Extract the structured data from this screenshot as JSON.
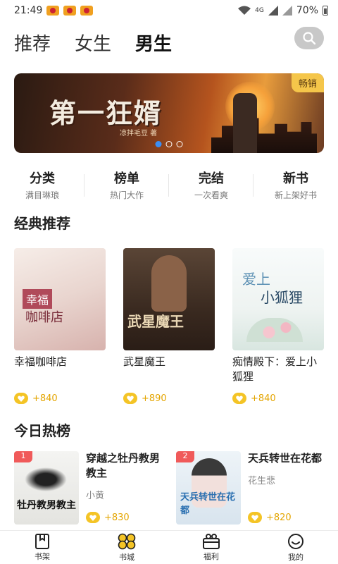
{
  "status_bar": {
    "time": "21:49",
    "network": "4G",
    "battery": "70%"
  },
  "top_tabs": [
    {
      "label": "推荐",
      "active": false
    },
    {
      "label": "女生",
      "active": false
    },
    {
      "label": "男生",
      "active": true
    }
  ],
  "banner": {
    "title": "第一狂婿",
    "author": "凉拌毛豆 著",
    "badge": "畅销",
    "dots": 3,
    "active_dot": 0
  },
  "categories": [
    {
      "title": "分类",
      "subtitle": "满目琳琅"
    },
    {
      "title": "榜单",
      "subtitle": "热门大作"
    },
    {
      "title": "完结",
      "subtitle": "一次看爽"
    },
    {
      "title": "新书",
      "subtitle": "新上架好书"
    }
  ],
  "classic": {
    "title": "经典推荐",
    "books": [
      {
        "name": "幸福咖啡店",
        "heat": "+840",
        "cover_line1": "幸福",
        "cover_line2": "咖啡店"
      },
      {
        "name": "武星魔王",
        "heat": "+890",
        "cover_line1": "武星魔王"
      },
      {
        "name": "痴情殿下：爱上小狐狸",
        "heat": "+840",
        "cover_line1": "爱上",
        "cover_line2": "小狐狸"
      }
    ]
  },
  "hot": {
    "title": "今日热榜",
    "books": [
      {
        "rank": "1",
        "name": "穿越之牡丹教男教主",
        "author": "小黄",
        "heat": "+830",
        "cover_text": "牡丹教男教主"
      },
      {
        "rank": "2",
        "name": "天兵转世在花都",
        "author": "花生悲",
        "heat": "+820",
        "cover_text": "天兵转世在花都"
      }
    ]
  },
  "bottom_nav": [
    {
      "label": "书架",
      "icon": "bookshelf-icon"
    },
    {
      "label": "书城",
      "icon": "bookstore-icon"
    },
    {
      "label": "福利",
      "icon": "gift-icon"
    },
    {
      "label": "我的",
      "icon": "profile-icon"
    }
  ],
  "colors": {
    "accent": "#f7d24a",
    "coin": "#f4c426",
    "heat_text": "#e4a500",
    "rank": "#f05a5a"
  }
}
